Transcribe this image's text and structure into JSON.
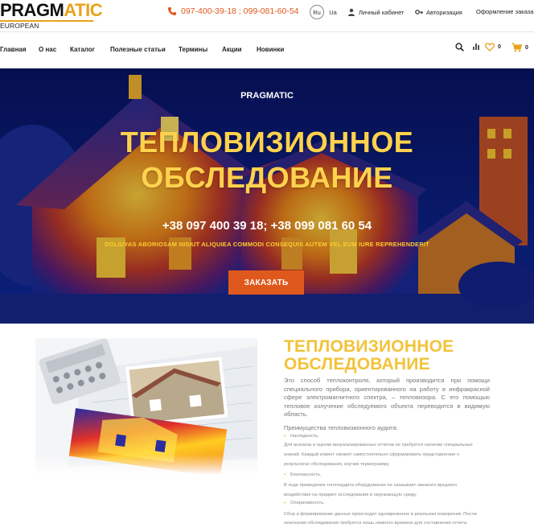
{
  "logo": {
    "word_main": "PRAGM",
    "word_hl": "ATIC",
    "subtitle": "EUROPEAN TECHNOLOGIES"
  },
  "header": {
    "phone": "097-400-39-18 ; 099-081-60-54",
    "lang_ru": "Ru",
    "lang_ua": "Ua",
    "cabinet": "Личный кабинет",
    "auth": "Авторизация",
    "checkout": "Оформление заказа"
  },
  "nav": {
    "items": [
      "Главная",
      "О нас",
      "Каталог",
      "Полезные статьи",
      "Термины",
      "Акции",
      "Новинки"
    ],
    "compare_count": "0",
    "wishlist_count": "0",
    "cart_count": "0"
  },
  "hero": {
    "brand": "PRAGMATIC",
    "title_line1": "ТЕПЛОВИЗИОННОЕ",
    "title_line2": "ОБСЛЕДОВАНИЕ",
    "phones": "+38 097 400 39 18; +38 099 081 60 54",
    "tagline": "DOLIUYAS ABORIOSAM NISIUT ALIQUIEA COMMODI CONSEQUIS AUTEM VEL EUM IURE REPREHENDERIT",
    "button": "ЗАКАЗАТЬ"
  },
  "section": {
    "title_line1": "ТЕПЛОВИЗИОННОЕ",
    "title_line2": "ОБСЛЕДОВАНИЕ",
    "intro": "Это способ теплоконтроля, который производится при помощи специального прибора, ориентированного на работу в инфракрасной сфере электромагнитного спектра, – тепловизора. С его помощью тепловое излучение обследуемого объекта переводится в видимую область.",
    "advantages_title": "Преимущества тепловизионного аудита:",
    "b1_title": "Наглядность.",
    "b1_line1": "Для анализа и оценки визуализированных отчетов не требуется наличие специальных",
    "b1_line2": "знаний. Каждый клиент сможет самостоятельно сформировать представление о",
    "b1_line3": "результатах обследования, изучив термограмму.",
    "b2_title": "Безопасность.",
    "b2_line1": "В ходе проведения теплоаудита оборудование не оказывает никакого вредного",
    "b2_line2": "воздействия на предмет исследования и окружающую среду.",
    "b3_title": "Оперативность.",
    "b3_line1": "Сбор и формирование данных происходит одновременно в реальном измерении. После",
    "b3_line2": "окончания обследования требуется лишь немного времени для составления отчета."
  },
  "colors": {
    "accent_orange": "#e0591c",
    "accent_yellow": "#f2c33a",
    "hero_blue": "#0a1f86"
  }
}
